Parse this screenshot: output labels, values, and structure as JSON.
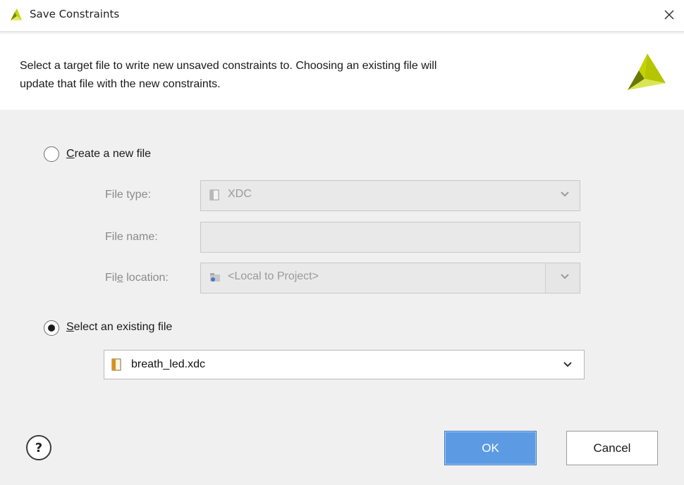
{
  "window": {
    "title": "Save Constraints",
    "close_icon": "close-icon",
    "logo_icon": "vivado-logo-icon"
  },
  "header": {
    "description_line1": "Select a target file to write new unsaved constraints to. Choosing an existing file will",
    "description_line2": "update that file with the new constraints."
  },
  "create_new": {
    "label_mnemonic": "C",
    "label_rest": "reate a new file",
    "selected": false,
    "file_type_label": "File type:",
    "file_type_value": "XDC",
    "file_name_label": "File name:",
    "file_name_value": "",
    "file_location_label_pre": "Fil",
    "file_location_label_mnemonic": "e",
    "file_location_label_post": " location:",
    "file_location_value": "<Local to Project>"
  },
  "select_existing": {
    "label_mnemonic": "S",
    "label_rest": "elect an existing file",
    "selected": true,
    "file_value": "breath_led.xdc"
  },
  "buttons": {
    "help": "?",
    "ok": "OK",
    "cancel": "Cancel"
  },
  "colors": {
    "accent": "#5c9be3",
    "logo_dark": "#7a8a00",
    "logo_light": "#d6e64a"
  }
}
